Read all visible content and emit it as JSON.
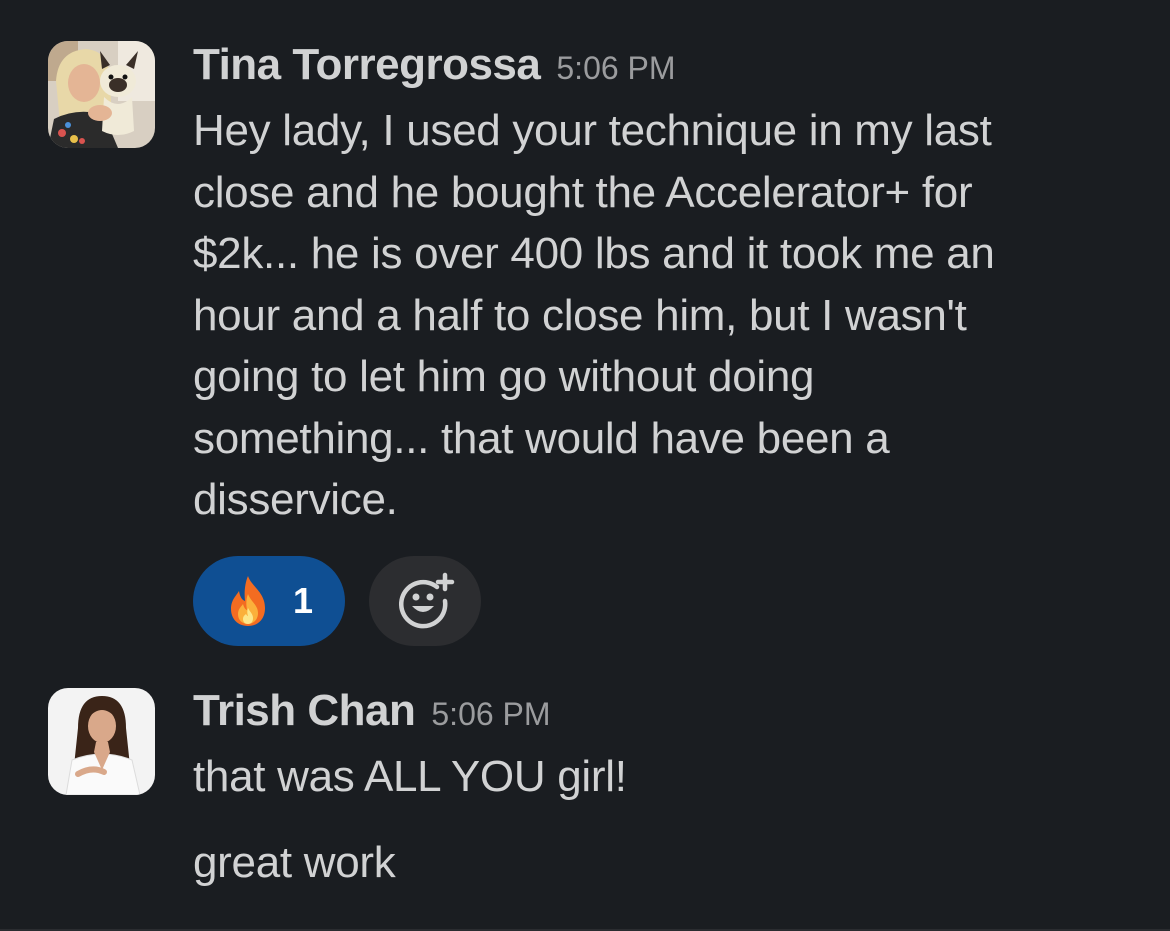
{
  "messages": [
    {
      "author": "Tina Torregrossa",
      "time": "5:06 PM",
      "avatar_icon": "user-photo-with-dog",
      "lines": [
        "Hey lady, I used your technique in my last",
        "close and he bought the Accelerator+ for",
        "$2k... he is over 400 lbs and it took me an",
        "hour and a half to close him, but I wasn't",
        "going to let him go without doing",
        "something... that would have been a",
        "disservice."
      ],
      "reactions": [
        {
          "emoji": "fire-emoji",
          "count": "1",
          "selected": true
        }
      ]
    },
    {
      "author": "Trish Chan",
      "time": "5:06 PM",
      "avatar_icon": "user-photo",
      "texts": [
        "that was ALL YOU girl!",
        "great work"
      ]
    }
  ],
  "add_reaction_icon": "add-emoji-icon",
  "colors": {
    "background": "#1a1d21",
    "text": "#d1d2d3",
    "timestamp": "#9b9c9e",
    "reaction_selected": "#0f4f93",
    "reaction_button": "#2c2d30"
  }
}
